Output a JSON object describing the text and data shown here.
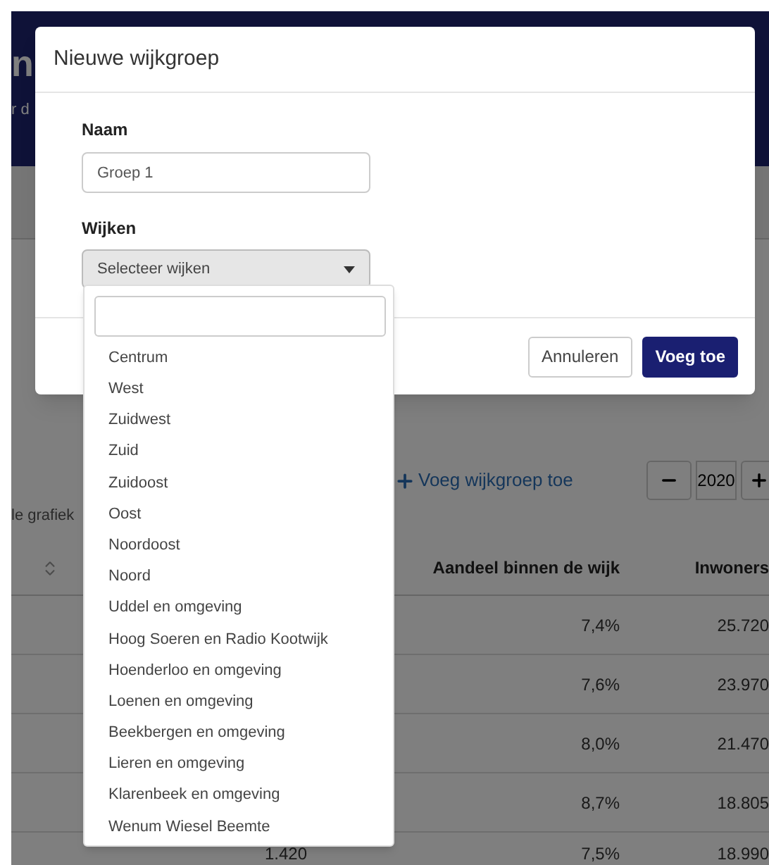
{
  "background": {
    "header_title": "n",
    "header_subtitle": "r d",
    "add_group_link": "Voeg wijkgroep toe",
    "year": "2020",
    "chart_label": "le grafiek",
    "table": {
      "columns": [
        "Aandeel binnen de wijk",
        "Inwoners"
      ],
      "rows": [
        {
          "share": "7,4%",
          "inhabitants": "25.720"
        },
        {
          "share": "7,6%",
          "inhabitants": "23.970"
        },
        {
          "share": "8,0%",
          "inhabitants": "21.470"
        },
        {
          "share": "8,7%",
          "inhabitants": "18.805"
        },
        {
          "column_1": "1.420",
          "share": "7,5%",
          "inhabitants": "18.990"
        }
      ]
    }
  },
  "dialog": {
    "title": "Nieuwe wijkgroep",
    "name_label": "Naam",
    "name_value": "Groep 1",
    "districts_label": "Wijken",
    "districts_select": "Selecteer wijken",
    "buttons": [
      {
        "label": "Annuleren",
        "kind": "secondary"
      },
      {
        "label": "Voeg toe",
        "kind": "primary"
      }
    ]
  },
  "dropdown": {
    "options": [
      "Centrum",
      "West",
      "Zuidwest",
      "Zuid",
      "Zuidoost",
      "Oost",
      "Noordoost",
      "Noord",
      "Uddel en omgeving",
      "Hoog Soeren en Radio Kootwijk",
      "Hoenderloo en omgeving",
      "Loenen en omgeving",
      "Beekbergen en omgeving",
      "Lieren en omgeving",
      "Klarenbeek en omgeving",
      "Wenum Wiesel Beemte"
    ]
  }
}
